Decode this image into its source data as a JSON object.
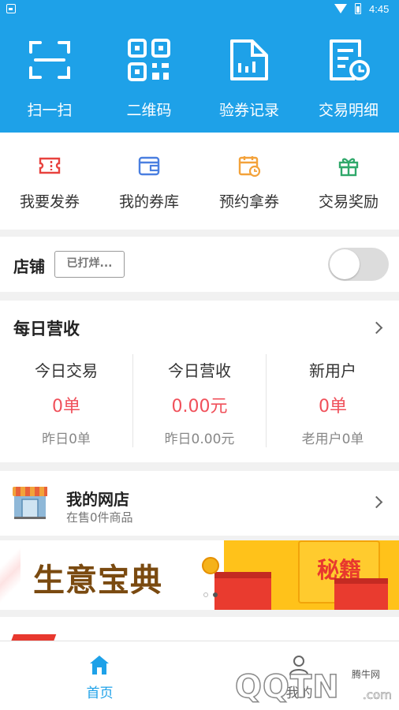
{
  "status_bar": {
    "time": "4:45"
  },
  "top_tools": [
    {
      "label": "扫一扫",
      "icon": "scan-icon"
    },
    {
      "label": "二维码",
      "icon": "qrcode-icon"
    },
    {
      "label": "验券记录",
      "icon": "coupon-record-icon"
    },
    {
      "label": "交易明细",
      "icon": "transaction-detail-icon"
    }
  ],
  "quick_actions": [
    {
      "label": "我要发券",
      "icon": "ticket-icon",
      "color": "#e8423e"
    },
    {
      "label": "我的券库",
      "icon": "wallet-icon",
      "color": "#4a7fe0"
    },
    {
      "label": "预约拿券",
      "icon": "calendar-icon",
      "color": "#f3a23a"
    },
    {
      "label": "交易奖励",
      "icon": "gift-icon",
      "color": "#2fa86a"
    }
  ],
  "shop": {
    "title": "店铺",
    "status_tag": "已打烊...",
    "toggle_on": false
  },
  "daily": {
    "title": "每日营收",
    "columns": [
      {
        "heading": "今日交易",
        "value": "0单",
        "sub": "昨日0单"
      },
      {
        "heading": "今日营收",
        "value": "0.00元",
        "sub": "昨日0.00元"
      },
      {
        "heading": "新用户",
        "value": "0单",
        "sub": "老用户0单"
      }
    ]
  },
  "webshop": {
    "title": "我的网店",
    "subtitle": "在售0件商品"
  },
  "banner": {
    "title": "生意宝典",
    "badge": "秘籍",
    "active_dot": 1
  },
  "bottom_nav": {
    "home_label": "首页",
    "mine_label": "我的",
    "active": "home"
  },
  "watermark": {
    "logo": "QQTN",
    "domain": ".com",
    "cn": "腾牛网"
  },
  "colors": {
    "primary": "#1ea1e8",
    "accent_red": "#f0505a"
  }
}
